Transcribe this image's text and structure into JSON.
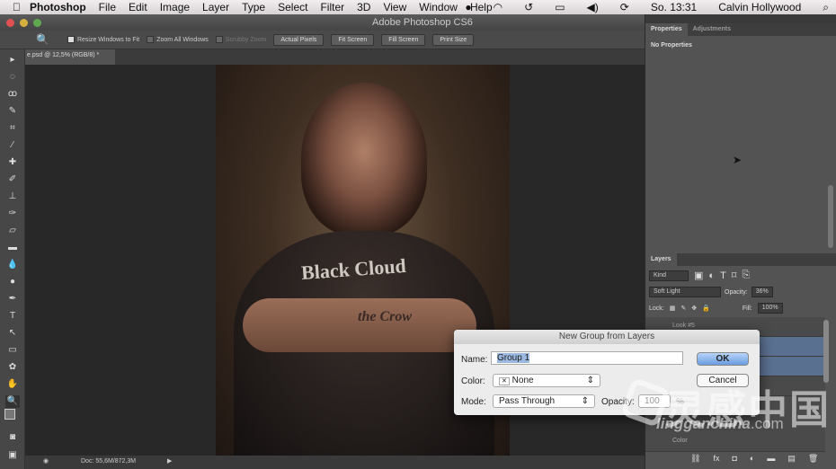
{
  "menubar": {
    "app": "Photoshop",
    "items": [
      "File",
      "Edit",
      "Image",
      "Layer",
      "Type",
      "Select",
      "Filter",
      "3D",
      "View",
      "Window",
      "Help"
    ],
    "clock": "So. 13:31",
    "user": "Calvin Hollywood"
  },
  "window": {
    "title": "Adobe Photoshop CS6"
  },
  "options": {
    "resize_windows": "Resize Windows to Fit",
    "zoom_all": "Zoom All Windows",
    "scrubby": "Scrubby Zoom",
    "actual_pixels": "Actual Pixels",
    "fit_screen": "Fit Screen",
    "fill_screen": "Fill Screen",
    "print_size": "Print Size"
  },
  "document": {
    "tab": "e.psd @ 12,5% (RGB/8) *",
    "doc_size": "Doc: 55,6M/872,3M"
  },
  "photo": {
    "shirt_text": "Black Cloud",
    "tattoo_text": "the Crow"
  },
  "properties": {
    "tabs": [
      "Properties",
      "Adjustments"
    ],
    "content": "No Properties"
  },
  "layers": {
    "title": "Layers",
    "filter": "Kind",
    "blend_mode": "Soft Light",
    "opacity_label": "Opacity:",
    "opacity": "36%",
    "lock_label": "Lock:",
    "fill_label": "Fill:",
    "fill": "100%",
    "rows": [
      "Look #5",
      "",
      "",
      "",
      "Color"
    ]
  },
  "dialog": {
    "title": "New Group from Layers",
    "name_label": "Name:",
    "name_value": "Group 1",
    "color_label": "Color:",
    "color_value": "None",
    "mode_label": "Mode:",
    "mode_value": "Pass Through",
    "opacity_label": "Opacity:",
    "opacity_value": "100",
    "opacity_unit": "%",
    "ok": "OK",
    "cancel": "Cancel"
  },
  "watermark": {
    "cn": "灵感中国",
    "site": "lingganchina",
    "tld": ".com"
  }
}
